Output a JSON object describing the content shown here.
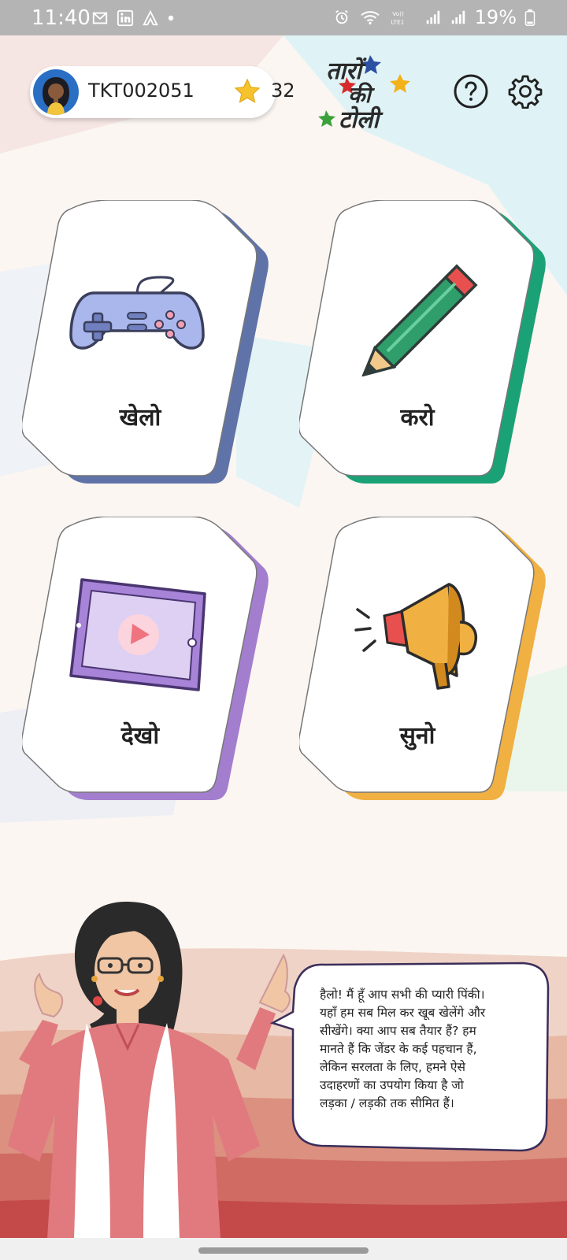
{
  "status_bar": {
    "time": "11:40",
    "battery": "19%",
    "icons_left": [
      "gmail-icon",
      "linkedin-icon",
      "app-icon",
      "dot-icon"
    ],
    "icons_right": [
      "alarm-icon",
      "wifi-icon",
      "volte-icon",
      "signal-icon",
      "signal-icon",
      "battery-icon"
    ]
  },
  "header": {
    "user_id": "TKT002051",
    "points": "32",
    "logo_text": "तारों की टोली",
    "help_icon": "help-circle-icon",
    "settings_icon": "gear-icon"
  },
  "cards": [
    {
      "label": "खेलो",
      "icon": "gamepad-icon",
      "accent": "#5f73a8"
    },
    {
      "label": "करो",
      "icon": "pencil-icon",
      "accent": "#1aa276"
    },
    {
      "label": "देखो",
      "icon": "video-tablet-icon",
      "accent": "#a37ecf"
    },
    {
      "label": "सुनो",
      "icon": "megaphone-icon",
      "accent": "#f0b042"
    }
  ],
  "speech": {
    "lines": [
      "हैलो! मैं हूँ आप सभी की प्यारी पिंकी।",
      "यहाँ हम सब मिल कर खूब खेलेंगे और",
      "सीखेंगे। क्या आप सब तैयार हैं? हम",
      "मानते हैं कि जेंडर के कई पहचान हैं,",
      "लेकिन सरलता के लिए, हमने ऐसे",
      "उदाहरणों का उपयोग किया है जो",
      "लड़का / लड़की तक सीमित हैं।"
    ]
  },
  "colors": {
    "background": "#fbf6f2",
    "star": "#f6c22d",
    "status_bar": "#b4b4b4"
  }
}
